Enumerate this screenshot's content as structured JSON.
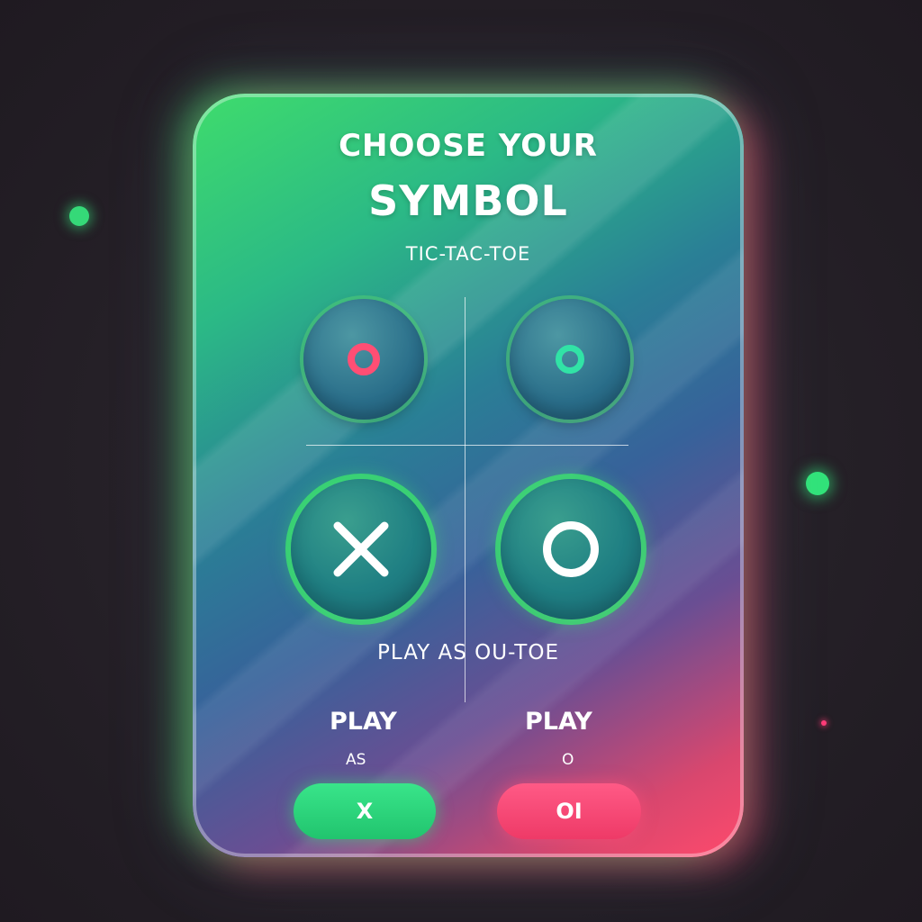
{
  "screen": {
    "title_line1": "CHOOSE YOUR",
    "title_line2": "SYMBOL",
    "subtitle": "TIC-TAC-TOE",
    "play_as_label": "PLAY AS OU-TOE"
  },
  "symbols": [
    {
      "id": "o-pink",
      "glyph": "O",
      "color": "#ff4e74"
    },
    {
      "id": "o-teal",
      "glyph": "O",
      "color": "#31e3a6"
    },
    {
      "id": "x-white",
      "glyph": "X",
      "color": "#ffffff"
    },
    {
      "id": "o-white",
      "glyph": "O",
      "color": "#ffffff"
    }
  ],
  "options": {
    "left": {
      "label": "PLAY",
      "sub": "AS",
      "button": "X",
      "color": "#2ad77a"
    },
    "right": {
      "label": "PLAY",
      "sub": "O",
      "button": "OI",
      "color": "#f5456f"
    }
  },
  "colors": {
    "background": "#272229",
    "card_green": "#3fdc6c",
    "card_pink": "#ff4a6c",
    "accent_green": "#35d978",
    "accent_pink": "#ff3c78"
  }
}
